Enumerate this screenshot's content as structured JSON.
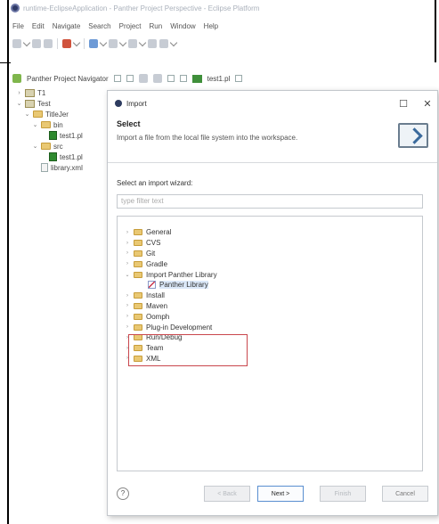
{
  "window": {
    "title": "runtime-EclipseApplication - Panther Project Perspective - Eclipse Platform"
  },
  "menubar": [
    "File",
    "Edit",
    "Navigate",
    "Search",
    "Project",
    "Run",
    "Window",
    "Help"
  ],
  "view_tabs": {
    "navigator_label": "Panther Project Navigator",
    "editor_label": "test1.pl"
  },
  "project_tree": [
    {
      "label": "T1",
      "twisty": "›",
      "indent": 0,
      "icon": "project-icon"
    },
    {
      "label": "Test",
      "twisty": "⌄",
      "indent": 0,
      "icon": "project-icon"
    },
    {
      "label": "TitleJer",
      "twisty": "⌄",
      "indent": 1,
      "icon": "folder-icon"
    },
    {
      "label": "bin",
      "twisty": "⌄",
      "indent": 2,
      "icon": "folder-icon"
    },
    {
      "label": "test1.pl",
      "twisty": "",
      "indent": 3,
      "icon": "file-icon"
    },
    {
      "label": "src",
      "twisty": "⌄",
      "indent": 2,
      "icon": "folder-icon"
    },
    {
      "label": "test1.pl",
      "twisty": "",
      "indent": 3,
      "icon": "file-icon"
    },
    {
      "label": "library.xml",
      "twisty": "",
      "indent": 2,
      "icon": "library-file-icon"
    }
  ],
  "dialog": {
    "title": "Import",
    "minimize_glyph": "☐",
    "close_glyph": "✕",
    "header_title": "Select",
    "header_desc": "Import a file from the local file system into the workspace.",
    "wizard_label": "Select an import wizard:",
    "filter_placeholder": "type filter text",
    "wizards": [
      {
        "label": "General",
        "twisty": "›"
      },
      {
        "label": "CVS",
        "twisty": "›"
      },
      {
        "label": "Git",
        "twisty": "›"
      },
      {
        "label": "Gradle",
        "twisty": "›"
      },
      {
        "label": "Import Panther Library",
        "twisty": "⌄"
      },
      {
        "label": "Panther Library",
        "twisty": "",
        "child": true,
        "selected": true
      },
      {
        "label": "Install",
        "twisty": "›"
      },
      {
        "label": "Maven",
        "twisty": "›"
      },
      {
        "label": "Oomph",
        "twisty": "›"
      },
      {
        "label": "Plug-in Development",
        "twisty": "›"
      },
      {
        "label": "Run/Debug",
        "twisty": "›"
      },
      {
        "label": "Team",
        "twisty": "›"
      },
      {
        "label": "XML",
        "twisty": "›"
      }
    ],
    "help_glyph": "?",
    "buttons": {
      "back": "< Back",
      "next": "Next >",
      "finish": "Finish",
      "cancel": "Cancel"
    }
  }
}
